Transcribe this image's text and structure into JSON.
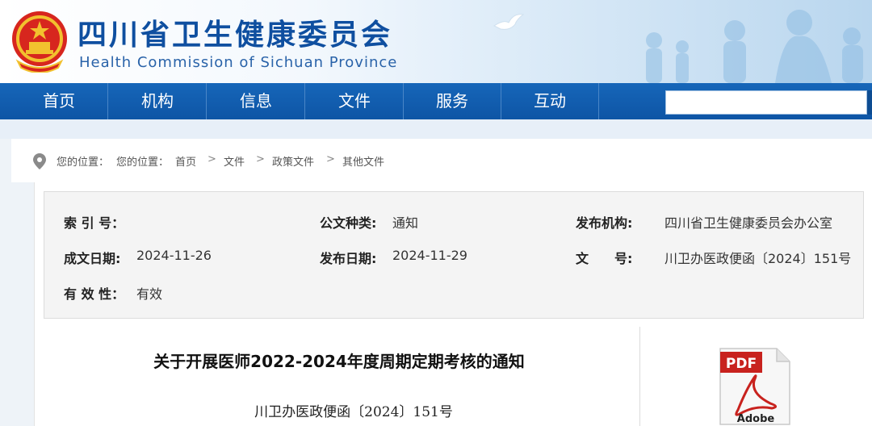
{
  "header": {
    "title_cn": "四川省卫生健康委员会",
    "title_en": "Health Commission of Sichuan Province"
  },
  "nav": {
    "items": [
      "首页",
      "机构",
      "信息",
      "文件",
      "服务",
      "互动"
    ],
    "search_placeholder": ""
  },
  "breadcrumb": {
    "label1": "您的位置：",
    "label2": "您的位置：",
    "items": [
      "首页",
      "文件",
      "政策文件",
      "其他文件"
    ],
    "separator": ">"
  },
  "meta": {
    "index_label": "索 引 号：",
    "index_value": "",
    "type_label": "公文种类:",
    "type_value": "通知",
    "issuer_label": "发布机构:",
    "issuer_value": "四川省卫生健康委员会办公室",
    "created_label": "成文日期:",
    "created_value": "2024-11-26",
    "published_label": "发布日期:",
    "published_value": "2024-11-29",
    "docno_label": "文　　号:",
    "docno_value": "川卫办医政便函〔2024〕151号",
    "validity_label": "有 效 性：",
    "validity_value": "有效"
  },
  "document": {
    "title": "关于开展医师2022-2024年度周期定期考核的通知",
    "number": "川卫办医政便函〔2024〕151号"
  },
  "pdf": {
    "top_label": "PDF",
    "bottom_label": "Adobe"
  },
  "colors": {
    "nav_blue": "#0e55a5",
    "title_blue": "#0f4fa0",
    "pdf_red": "#c8221e"
  }
}
